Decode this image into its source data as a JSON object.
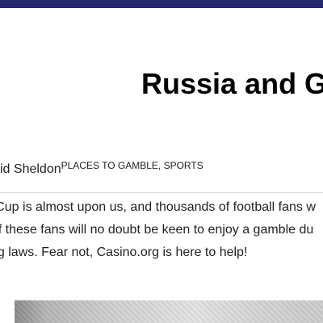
{
  "header": {
    "bar_color": "#24296b"
  },
  "article": {
    "title": "Russia and G",
    "byline": {
      "author": "vid Sheldon",
      "categories": [
        "PLACES TO GAMBLE",
        "SPORTS"
      ],
      "separator": ", "
    },
    "body_lines": [
      "rld Cup is almost upon us, and thousands of football fans w",
      "ty of these fans will no doubt be keen to enjoy a gamble du",
      "bling laws. Fear not, Casino.org is here to help!"
    ]
  }
}
